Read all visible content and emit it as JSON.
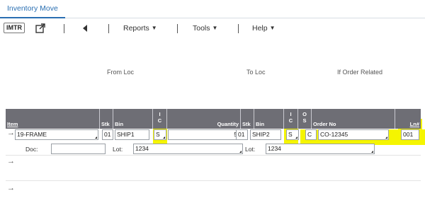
{
  "tab": {
    "label": "Inventory Move"
  },
  "toolbar": {
    "imtr_label": "IMTR",
    "external_icon": "external-link-icon",
    "back_icon": "back-triangle-icon",
    "menus": [
      "Reports",
      "Tools",
      "Help"
    ]
  },
  "groups": {
    "from_loc": "From Loc",
    "to_loc": "To Loc",
    "if_order_related": "If Order Related"
  },
  "columns": {
    "item": "Item",
    "stk1": "Stk",
    "bin1": "Bin",
    "ic": [
      "I",
      "C"
    ],
    "quantity": "Quantity",
    "stk2": "Stk",
    "bin2": "Bin",
    "ic2": [
      "I",
      "C"
    ],
    "os": [
      "O",
      "S"
    ],
    "order_no": "Order No",
    "ln": "Ln#"
  },
  "row1": {
    "item": "19-FRAME",
    "stk1": "01",
    "bin1": "SHIP1",
    "ic1": "S",
    "quantity": "5",
    "stk2": "01",
    "bin2": "SHIP2",
    "ic2": "S",
    "os": "C",
    "order_no": "CO-12345",
    "ln": "001"
  },
  "row1_detail": {
    "doc_label": "Doc:",
    "doc_value": "",
    "lot_label": "Lot:",
    "lot_from": "1234",
    "lot_label2": "Lot:",
    "lot_to": "1234"
  },
  "highlight_color": "#f5f500",
  "header_color": "#6e6e75",
  "accent_color": "#2a6fb2"
}
